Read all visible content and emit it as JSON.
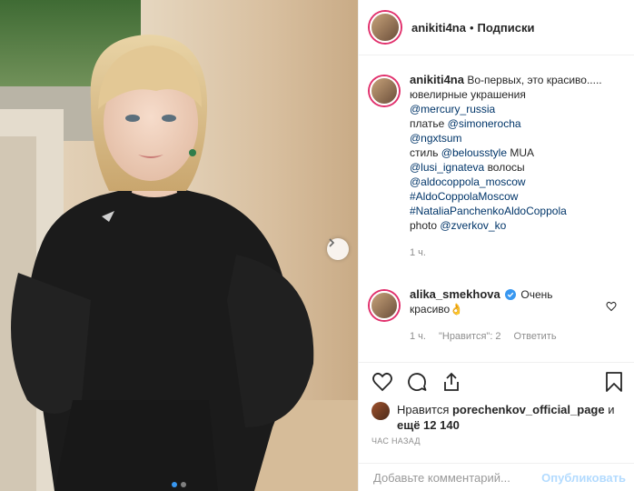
{
  "post": {
    "author": "anikiti4na",
    "separator": "•",
    "follow_label": "Подписки"
  },
  "caption": {
    "author": "anikiti4na",
    "lines": [
      "Во-первых, это красиво.....",
      "ювелирные украшения",
      "@mercury_russia",
      "платье ",
      "@simonerocha",
      "@ngxtsum",
      "стиль ",
      "@belousstyle",
      " MUA",
      "@lusi_ignateva",
      " волосы",
      "@aldocoppola_moscow",
      "#AldoCoppolaMoscow",
      "#NataliaPanchenkoAldoCoppola",
      "photo ",
      "@zverkov_ko"
    ],
    "time": "1 ч."
  },
  "reply": {
    "author": "alika_smekhova",
    "text_a": "Очень",
    "text_b": "красиво👌",
    "time": "1 ч.",
    "likes": "\"Нравится\": 2",
    "reply_label": "Ответить"
  },
  "likes": {
    "prefix": "Нравится ",
    "user": "porechenkov_official_page",
    "mid": " и",
    "more": "ещё 12 140"
  },
  "timestamp": "ЧАС НАЗАД",
  "comment_box": {
    "placeholder": "Добавьте комментарий...",
    "post_label": "Опубликовать"
  },
  "colors": {
    "link": "#003569",
    "accent": "#3897f0",
    "muted": "#8e8e8e"
  },
  "icons": [
    "heart-icon",
    "comment-icon",
    "share-icon",
    "bookmark-icon",
    "verified-icon",
    "chevron-right-icon"
  ]
}
